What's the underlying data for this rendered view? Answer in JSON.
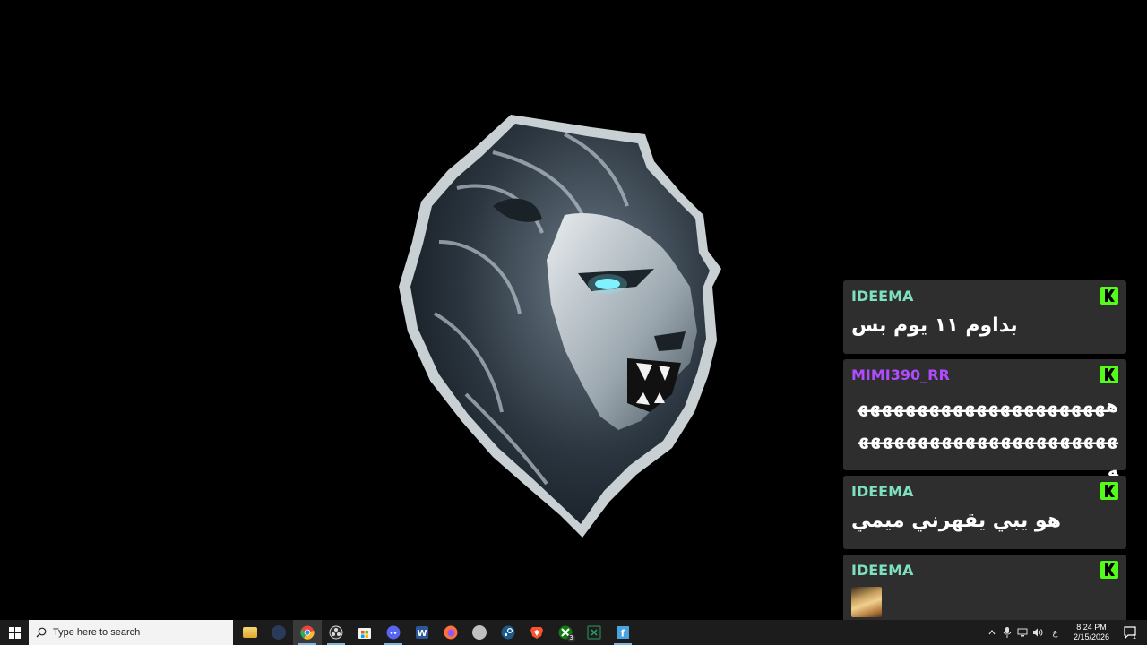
{
  "chat": {
    "messages": [
      {
        "username": "IDEEMA",
        "color": "#7fe0c0",
        "text": "بداوم ١١ يوم بس"
      },
      {
        "username": "MIMI390_RR",
        "color": "#b04cff",
        "text": "ههههههههههههههههههههههههههههههههههههههههههههه"
      },
      {
        "username": "IDEEMA",
        "color": "#7fe0c0",
        "text": "هو يبي يقهرني ميمي"
      },
      {
        "username": "IDEEMA",
        "color": "#7fe0c0",
        "emote": "baby-emote"
      }
    ],
    "platform_icon": "kick-icon",
    "platform_color": "#53fc18"
  },
  "taskbar": {
    "search_placeholder": "Type here to search",
    "apps": [
      {
        "name": "file-explorer-icon",
        "color": "#f2c14b"
      },
      {
        "name": "discord-like-app-icon",
        "color": "#2a3a5a"
      },
      {
        "name": "chrome-icon",
        "color": "#e8453c",
        "active": true
      },
      {
        "name": "obs-icon",
        "color": "#444"
      },
      {
        "name": "microsoft-store-icon",
        "color": "#f0f0f0"
      },
      {
        "name": "discord-icon",
        "color": "#5865f2"
      },
      {
        "name": "word-icon",
        "color": "#2b579a"
      },
      {
        "name": "firefox-icon",
        "color": "#ff7139"
      },
      {
        "name": "rocket-app-icon",
        "color": "#c0c0c0"
      },
      {
        "name": "steam-icon",
        "color": "#1b2838"
      },
      {
        "name": "brave-icon",
        "color": "#fb542b"
      },
      {
        "name": "xbox-icon",
        "color": "#107c10",
        "badge": "3"
      },
      {
        "name": "excel-icon",
        "color": "#217346"
      },
      {
        "name": "fb-app-icon",
        "color": "#4aa3df"
      }
    ],
    "tray": {
      "language": "ع",
      "time": "8:24 PM",
      "date": "2/15/2026",
      "notification_count": "1"
    }
  }
}
